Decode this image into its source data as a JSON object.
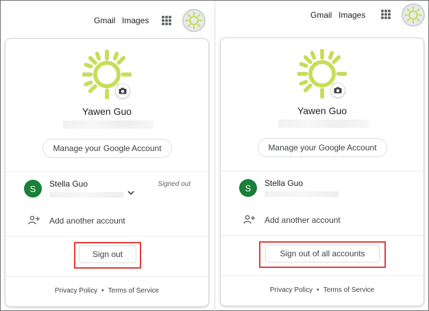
{
  "left_panel": {
    "topbar": {
      "gmail": "Gmail",
      "images": "Images",
      "apps_icon": "apps-grid-icon"
    },
    "card": {
      "user_name": "Yawen Guo",
      "manage_button": "Manage your Google Account",
      "other_account": {
        "initial": "S",
        "name": "Stella Guo",
        "status": "Signed out",
        "avatar_color": "#188038"
      },
      "add_account": "Add another account",
      "sign_out_button": "Sign out",
      "footer": {
        "privacy": "Privacy Policy",
        "dot": "•",
        "terms": "Terms of Service"
      }
    }
  },
  "right_panel": {
    "topbar": {
      "gmail": "Gmail",
      "images": "Images",
      "apps_icon": "apps-grid-icon"
    },
    "card": {
      "user_name": "Yawen Guo",
      "manage_button": "Manage your Google Account",
      "other_account": {
        "initial": "S",
        "name": "Stella Guo",
        "avatar_color": "#188038"
      },
      "add_account": "Add another account",
      "sign_out_button": "Sign out of all accounts",
      "footer": {
        "privacy": "Privacy Policy",
        "dot": "•",
        "terms": "Terms of Service"
      }
    }
  },
  "colors": {
    "highlight_box": "#e53935",
    "sun": "#c9dc5a",
    "account_avatar": "#188038"
  }
}
